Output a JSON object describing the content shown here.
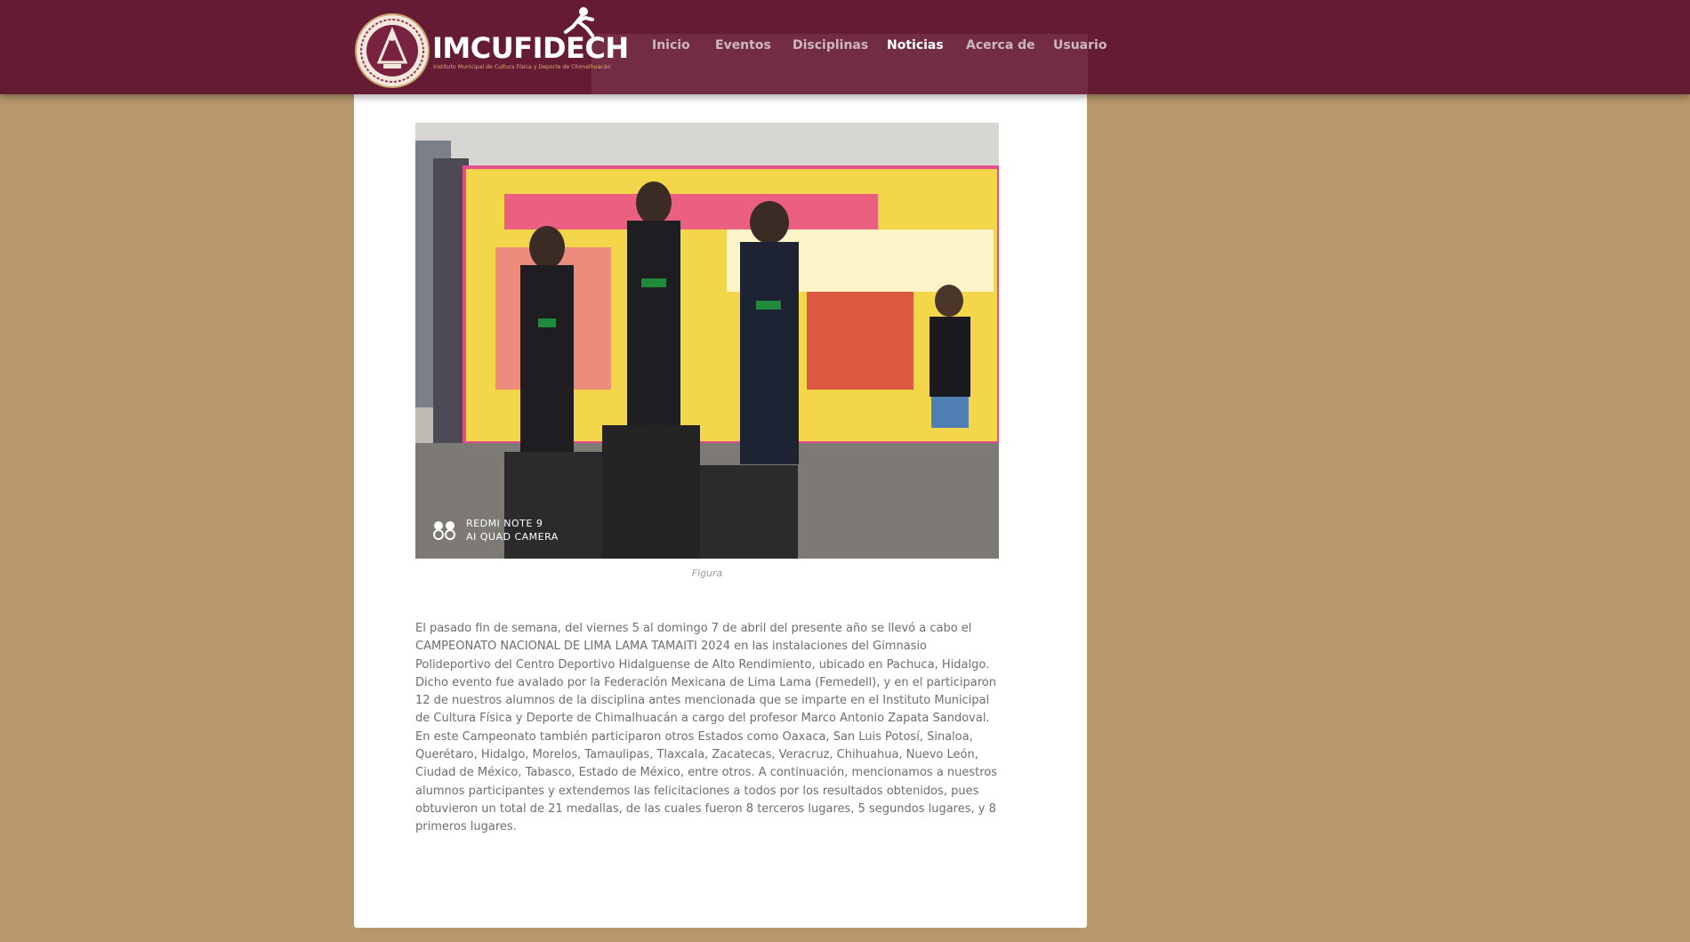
{
  "header": {
    "logo_text": "IMCUFIDECH",
    "logo_subtitle": "Instituto Municipal de Cultura Física y Deporte de Chimalhuacán",
    "nav": [
      "Inicio",
      "Eventos",
      "Disciplinas",
      "Noticias",
      "Acerca de",
      "Usuario"
    ],
    "active_nav": "Noticias"
  },
  "article": {
    "image_alt": "Figura",
    "image_watermark": [
      "REDMI NOTE 9",
      "AI QUAD CAMERA"
    ],
    "caption": "Figura",
    "body": "El pasado fin de semana, del viernes 5 al domingo 7 de abril del presente año se llevó a cabo el CAMPEONATO NACIONAL DE LIMA LAMA TAMAITI 2024 en las instalaciones del Gimnasio Polideportivo del Centro Deportivo Hidalguense de Alto Rendimiento, ubicado en Pachuca, Hidalgo. Dicho evento fue avalado por la Federación Mexicana de Lima Lama (Femedell), y en el participaron 12 de nuestros alumnos de la disciplina antes mencionada que se imparte en el Instituto Municipal de Cultura Física y Deporte de Chimalhuacán a cargo del profesor Marco Antonio Zapata Sandoval. En este Campeonato también participaron otros Estados como Oaxaca, San Luis Potosí, Sinaloa, Querétaro, Hidalgo, Morelos, Tamaulipas, Tlaxcala, Zacatecas, Veracruz, Chihuahua, Nuevo León, Ciudad de México, Tabasco, Estado de México, entre otros. A continuación, mencionamos a nuestros alumnos participantes y extendemos las felicitaciones a todos por los resultados obtenidos, pues obtuvieron un total de 21 medallas, de las cuales fueron 8 terceros lugares, 5 segundos lugares, y 8 primeros lugares."
  },
  "colors": {
    "header_bg": "#661b35",
    "page_bg": "#b8976a",
    "card_bg": "#ffffff",
    "nav_active": "#ffffff",
    "nav_inactive": "#cfb6c0",
    "text": "#6e6e6e"
  }
}
